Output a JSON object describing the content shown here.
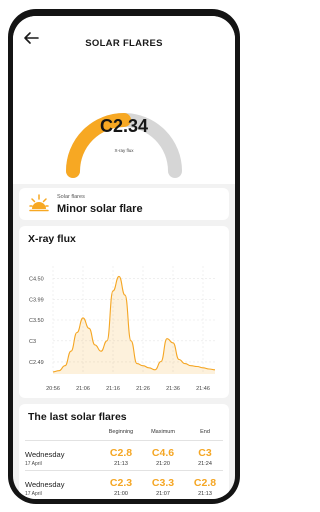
{
  "header": {
    "title": "SOLAR FLARES",
    "back_icon": "arrow-left-icon"
  },
  "gauge": {
    "value": "C2.34",
    "caption": "X-ray flux",
    "fill_fraction": 0.5,
    "fill_color": "#F7A823",
    "track_color": "#D6D6D6"
  },
  "flare": {
    "label": "Solar flares",
    "value": "Minor solar flare",
    "icon": "sun-icon"
  },
  "chart": {
    "title": "X-ray flux",
    "accent": "#F5A623"
  },
  "chart_data": {
    "type": "area",
    "title": "X-ray flux",
    "y_tick_labels": [
      "C4.50",
      "C3.99",
      "C3.50",
      "C3",
      "C2.49"
    ],
    "x_tick_labels": [
      "20:56",
      "21:06",
      "21:16",
      "21:26",
      "21:36",
      "21:46"
    ],
    "series": [
      {
        "x": [
          "20:56",
          "20:58",
          "21:00",
          "21:02",
          "21:04",
          "21:06",
          "21:08",
          "21:10",
          "21:12",
          "21:14",
          "21:16",
          "21:18",
          "21:20",
          "21:22",
          "21:24",
          "21:26",
          "21:28",
          "21:30",
          "21:32",
          "21:34",
          "21:36",
          "21:38",
          "21:40",
          "21:42",
          "21:44",
          "21:46",
          "21:48",
          "21:50"
        ],
        "values": [
          2.25,
          2.28,
          2.4,
          2.75,
          3.2,
          3.55,
          3.3,
          2.9,
          2.75,
          3.0,
          4.2,
          4.55,
          4.1,
          3.0,
          2.45,
          2.4,
          2.35,
          2.3,
          2.5,
          3.05,
          2.95,
          2.55,
          2.45,
          2.4,
          2.38,
          2.35,
          2.32,
          2.3
        ]
      }
    ]
  },
  "table": {
    "title": "The last solar flares",
    "columns": [
      "Beginning",
      "Maximum",
      "End"
    ],
    "rows": [
      {
        "day": "Wednesday",
        "date": "17 April",
        "beginning": "C2.8",
        "beginning_time": "21:13",
        "maximum": "C4.6",
        "maximum_time": "21:20",
        "end": "C3",
        "end_time": "21:24"
      },
      {
        "day": "Wednesday",
        "date": "17 April",
        "beginning": "C2.3",
        "beginning_time": "21:00",
        "maximum": "C3.3",
        "maximum_time": "21:07",
        "end": "C2.8",
        "end_time": "21:13"
      }
    ]
  }
}
